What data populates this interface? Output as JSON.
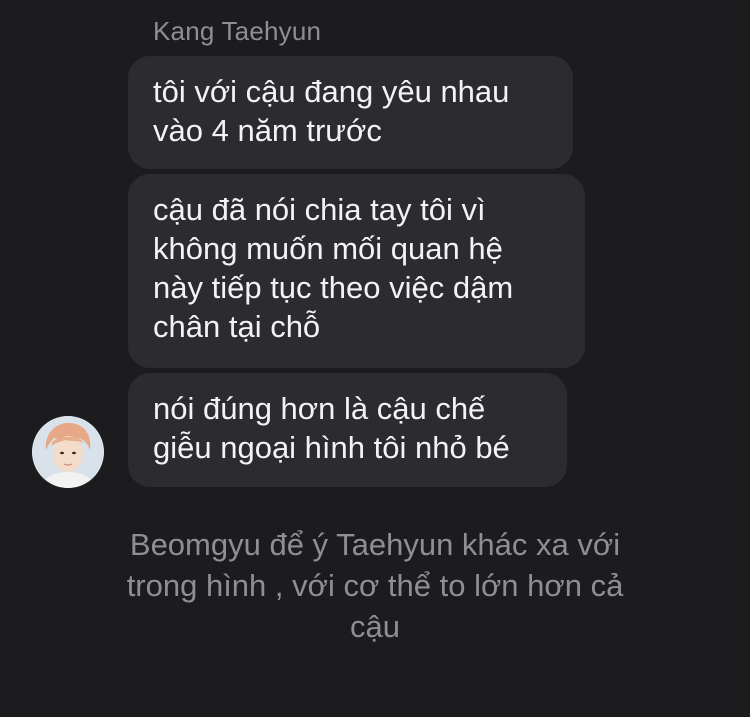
{
  "conversation": {
    "sender_name": "Kang Taehyun",
    "messages": [
      {
        "text": "tôi với cậu đang yêu nhau\nvào 4 năm trước"
      },
      {
        "text": "cậu đã nói chia tay tôi vì\nkhông muốn mối quan hệ\nnày tiếp tục theo việc dậm\nchân tại chỗ"
      },
      {
        "text": "nói đúng hơn là cậu chế\ngiễu ngoại hình tôi nhỏ bé"
      }
    ],
    "caption": "Beomgyu để ý Taehyun khác xa với\ntrong hình , với cơ thể to lớn hơn cả\ncậu"
  },
  "colors": {
    "background": "#1c1c1e",
    "bubble": "#2c2c2e",
    "text": "#f2f2f7",
    "muted": "#8e8e93"
  }
}
